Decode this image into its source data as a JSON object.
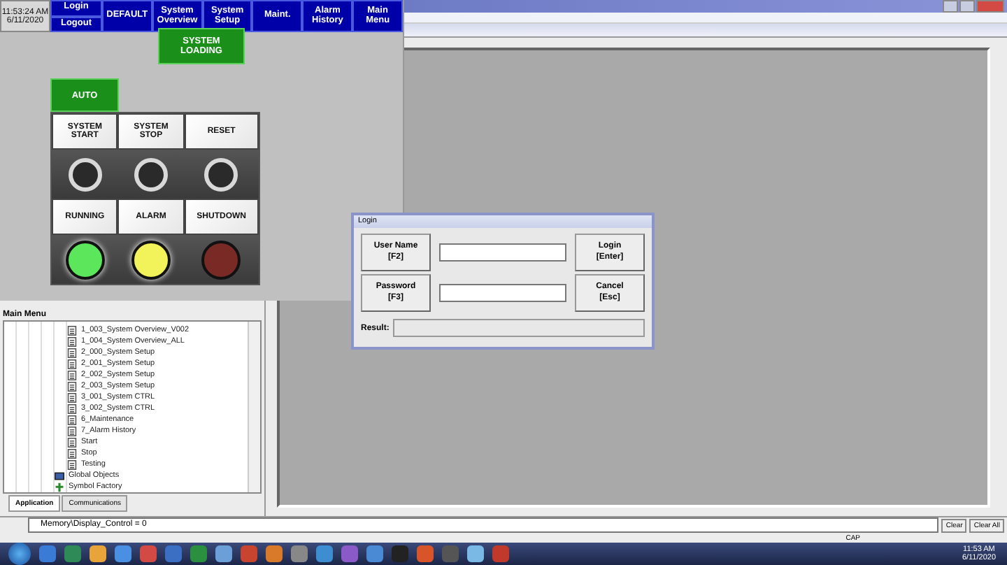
{
  "hmi": {
    "clock": {
      "time": "11:53:24 AM",
      "date": "6/11/2020"
    },
    "login_buttons": [
      "Login",
      "Logout"
    ],
    "nav": [
      {
        "label": "DEFAULT",
        "selected": false
      },
      {
        "label": "System Overview",
        "selected": false
      },
      {
        "label": "System Setup",
        "selected": false
      },
      {
        "label": "Maint.",
        "selected": false
      },
      {
        "label": "Alarm History",
        "selected": false
      },
      {
        "label": "Main Menu",
        "selected": false
      }
    ],
    "loading_button": "SYSTEM LOADING",
    "auto_button": "AUTO",
    "pushbuttons": [
      {
        "label": "SYSTEM START"
      },
      {
        "label": "SYSTEM STOP"
      },
      {
        "label": "RESET"
      }
    ],
    "indicators": [
      {
        "label": "RUNNING",
        "color": "#5ce65c",
        "on": true
      },
      {
        "label": "ALARM",
        "color": "#f2f25a",
        "on": true
      },
      {
        "label": "SHUTDOWN",
        "color": "#7a2a25",
        "on": false
      }
    ]
  },
  "tree": {
    "title": "Main Menu",
    "items": [
      {
        "label": "1_003_System Overview_V002",
        "kind": "screen"
      },
      {
        "label": "1_004_System Overview_ALL",
        "kind": "screen"
      },
      {
        "label": "2_000_System Setup",
        "kind": "screen"
      },
      {
        "label": "2_001_System Setup",
        "kind": "screen"
      },
      {
        "label": "2_002_System Setup",
        "kind": "screen"
      },
      {
        "label": "2_003_System Setup",
        "kind": "screen"
      },
      {
        "label": "3_001_System CTRL",
        "kind": "screen"
      },
      {
        "label": "3_002_System CTRL",
        "kind": "screen"
      },
      {
        "label": "6_Maintenance",
        "kind": "screen"
      },
      {
        "label": "7_Alarm History",
        "kind": "screen"
      },
      {
        "label": "Start",
        "kind": "screen"
      },
      {
        "label": "Stop",
        "kind": "screen"
      },
      {
        "label": "Testing",
        "kind": "screen"
      },
      {
        "label": "Global Objects",
        "kind": "folder"
      },
      {
        "label": "Symbol Factory",
        "kind": "symbols"
      }
    ],
    "tabs": [
      {
        "label": "Application",
        "selected": true
      },
      {
        "label": "Communications",
        "selected": false
      }
    ]
  },
  "login": {
    "title": "Login",
    "user_button": "User Name\n[F2]",
    "password_button": "Password\n[F3]",
    "login_button": "Login\n[Enter]",
    "cancel_button": "Cancel\n[Esc]",
    "result_label": "Result:"
  },
  "output": {
    "message": "Memory\\Display_Control = 0",
    "buttons": [
      "Clear",
      "Clear All"
    ]
  },
  "status_bar": {
    "caps": "CAP"
  },
  "taskbar": {
    "time": "11:53 AM",
    "date": "6/11/2020"
  }
}
